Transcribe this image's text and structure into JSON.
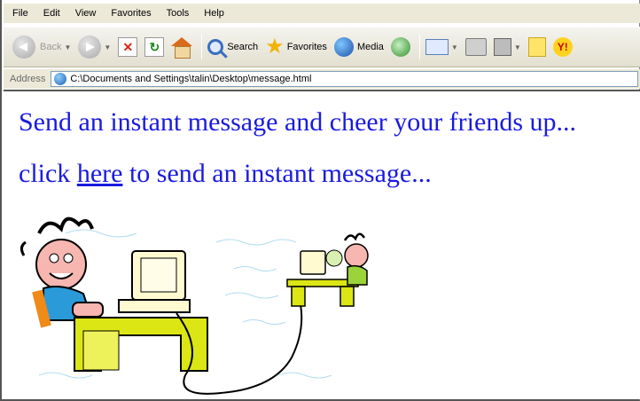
{
  "menu": [
    "File",
    "Edit",
    "View",
    "Favorites",
    "Tools",
    "Help"
  ],
  "toolbar": {
    "back_label": "Back",
    "search_label": "Search",
    "favorites_label": "Favorites",
    "media_label": "Media"
  },
  "address": {
    "label": "Address",
    "value": "C:\\Documents and Settings\\talin\\Desktop\\message.html"
  },
  "page": {
    "headline": "Send an instant message and cheer your friends up...",
    "line2_before": "click ",
    "line2_link": "here",
    "line2_after": " to send an instant message..."
  },
  "colors": {
    "text_blue": "#1a1ae0",
    "chrome": "#ECE9D8"
  },
  "icons": [
    "back-icon",
    "forward-icon",
    "stop-icon",
    "refresh-icon",
    "home-icon",
    "search-icon",
    "favorites-star-icon",
    "media-icon",
    "history-icon",
    "mail-icon",
    "print-icon",
    "edit-icon",
    "messenger-icon",
    "yahoo-icon"
  ]
}
